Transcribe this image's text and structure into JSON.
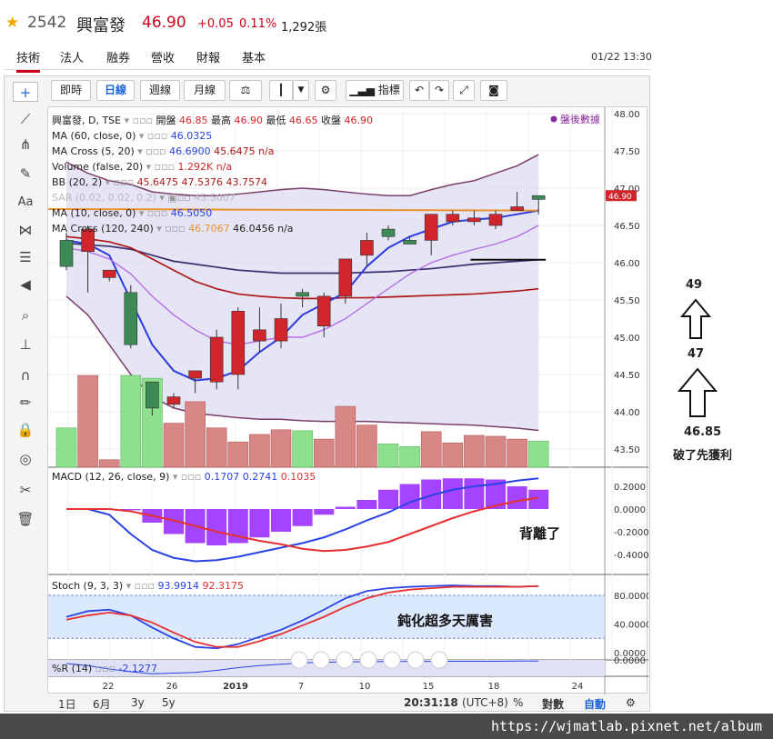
{
  "header": {
    "code": "2542",
    "name": "興富發",
    "price": "46.90",
    "change": "+0.05",
    "change_pct": "0.11%",
    "volume": "1,292張"
  },
  "nav": {
    "tabs": [
      "技術",
      "法人",
      "營收",
      "營收",
      "財報",
      "基本"
    ],
    "active": "技術",
    "time": "01/22 13:30"
  },
  "toolbar": {
    "realtime": "即時",
    "daily": "日線",
    "weekly": "週線",
    "monthly": "月線",
    "indicator": "指標"
  },
  "legend": {
    "title": "興富發, D, TSE",
    "open_label": "開盤",
    "open": "46.85",
    "high_label": "最高",
    "high": "46.90",
    "low_label": "最低",
    "low": "46.65",
    "close_label": "收盤",
    "close": "46.90",
    "after_hours": "盤後數據",
    "ma60_label": "MA (60, close, 0)",
    "ma60": "46.0325",
    "macross1_label": "MA Cross (5, 20)",
    "macross1_a": "46.6900",
    "macross1_b": "45.6475",
    "macross1_c": "n/a",
    "volume_label": "Volume (false, 20)",
    "volume_val": "1.292K",
    "volume_c": "n/a",
    "bb_label": "BB (20, 2)",
    "bb_a": "45.6475",
    "bb_b": "47.5376",
    "bb_c": "43.7574",
    "sar_label": "SAR (0.02, 0.02, 0.2)",
    "sar": "45.5007",
    "ma10_label": "MA (10, close, 0)",
    "ma10": "46.5050",
    "macross2_label": "MA Cross (120, 240)",
    "macross2_a": "46.7067",
    "macross2_b": "46.0456",
    "macross2_c": "n/a",
    "macd_label": "MACD (12, 26, close, 9)",
    "macd_a": "0.1707",
    "macd_b": "0.2741",
    "macd_c": "0.1035",
    "stoch_label": "Stoch (9, 3, 3)",
    "stoch_a": "93.9914",
    "stoch_b": "92.3175",
    "r_label": "%R (14)",
    "r_val": "-2.1277"
  },
  "chart_data": {
    "type": "candlestick",
    "x_tick_labels": [
      "22",
      "26",
      "2019",
      "7",
      "10",
      "15",
      "18",
      "24"
    ],
    "price_axis_ticks": [
      "48.00",
      "47.50",
      "47.00",
      "46.50",
      "46.00",
      "45.50",
      "45.00",
      "44.50",
      "44.00",
      "43.50"
    ],
    "price_ylim": [
      43.3,
      48.0
    ],
    "current_price_tag": "46.90",
    "candles": [
      {
        "o": 46.3,
        "h": 46.4,
        "l": 45.9,
        "c": 45.95
      },
      {
        "o": 46.15,
        "h": 46.5,
        "l": 45.6,
        "c": 46.45
      },
      {
        "o": 45.8,
        "h": 45.9,
        "l": 45.75,
        "c": 45.9
      },
      {
        "o": 45.6,
        "h": 45.7,
        "l": 44.85,
        "c": 44.9
      },
      {
        "o": 44.4,
        "h": 44.4,
        "l": 43.95,
        "c": 44.05
      },
      {
        "o": 44.1,
        "h": 44.25,
        "l": 44.05,
        "c": 44.2
      },
      {
        "o": 44.45,
        "h": 44.5,
        "l": 44.25,
        "c": 44.55
      },
      {
        "o": 44.4,
        "h": 45.1,
        "l": 44.3,
        "c": 45.0
      },
      {
        "o": 44.5,
        "h": 45.4,
        "l": 44.3,
        "c": 45.35
      },
      {
        "o": 44.95,
        "h": 45.4,
        "l": 44.8,
        "c": 45.1
      },
      {
        "o": 44.95,
        "h": 45.45,
        "l": 44.85,
        "c": 45.25
      },
      {
        "o": 45.6,
        "h": 45.65,
        "l": 45.4,
        "c": 45.55
      },
      {
        "o": 45.15,
        "h": 45.6,
        "l": 45.0,
        "c": 45.55
      },
      {
        "o": 45.55,
        "h": 46.0,
        "l": 45.45,
        "c": 46.05
      },
      {
        "o": 46.1,
        "h": 46.4,
        "l": 45.95,
        "c": 46.3
      },
      {
        "o": 46.45,
        "h": 46.5,
        "l": 46.3,
        "c": 46.35
      },
      {
        "o": 46.3,
        "h": 46.35,
        "l": 46.25,
        "c": 46.25
      },
      {
        "o": 46.3,
        "h": 46.65,
        "l": 46.1,
        "c": 46.65
      },
      {
        "o": 46.55,
        "h": 46.7,
        "l": 46.5,
        "c": 46.65
      },
      {
        "o": 46.55,
        "h": 46.7,
        "l": 46.5,
        "c": 46.6
      },
      {
        "o": 46.5,
        "h": 46.7,
        "l": 46.45,
        "c": 46.65
      },
      {
        "o": 46.7,
        "h": 46.95,
        "l": 46.7,
        "c": 46.75
      },
      {
        "o": 46.9,
        "h": 46.9,
        "l": 46.65,
        "c": 46.85
      }
    ],
    "macd_axis_ticks": [
      "0.2000",
      "0.0000",
      "-0.2000",
      "-0.4000"
    ],
    "stoch_axis_ticks": [
      "80.0000",
      "40.0000",
      "0.0000"
    ],
    "r_axis_ticks": [
      "0.0000"
    ]
  },
  "bottom_bar": {
    "ranges": [
      "1日",
      "6月",
      "3y",
      "5y"
    ],
    "clock": "20:31:18",
    "tz": "(UTC+8)",
    "pct": "%",
    "log": "對數",
    "auto": "自動"
  },
  "annotations": {
    "target": "49",
    "mid": "47",
    "stop": "46.85",
    "stop_note": "破了先獲利",
    "macd_note": "背離了",
    "stoch_note": "鈍化超多天厲害"
  },
  "footer": {
    "url": "https://wjmatlab.pixnet.net/album"
  }
}
